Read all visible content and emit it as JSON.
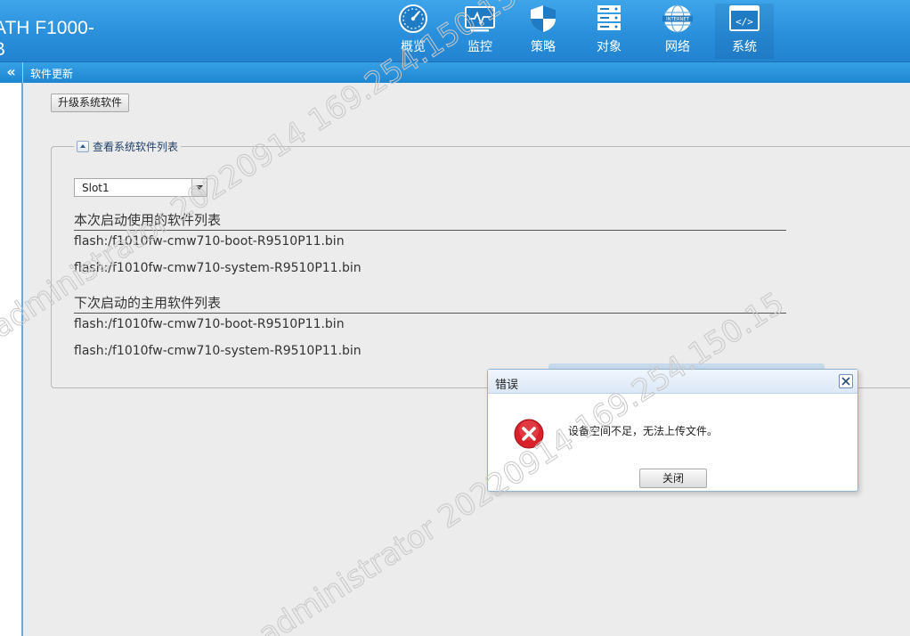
{
  "header": {
    "product_line1": "ATH F1000-",
    "product_line2": "B",
    "nav": [
      {
        "label": "概览",
        "icon": "dashboard-gauge-icon"
      },
      {
        "label": "监控",
        "icon": "monitor-pulse-icon"
      },
      {
        "label": "策略",
        "icon": "shield-icon"
      },
      {
        "label": "对象",
        "icon": "server-stack-icon"
      },
      {
        "label": "网络",
        "icon": "internet-globe-icon"
      },
      {
        "label": "系统",
        "icon": "code-window-icon"
      }
    ],
    "internet_badge": "INTERNET",
    "code_glyph": "</>",
    "active_nav": "系统"
  },
  "subheader": {
    "collapse_glyph": "«",
    "title": "软件更新"
  },
  "content": {
    "upgrade_button": "升级系统软件",
    "section_legend": "查看系统软件列表",
    "slot_select": {
      "value": "Slot1"
    },
    "current_boot": {
      "title": "本次启动使用的软件列表",
      "files": [
        "flash:/f1010fw-cmw710-boot-R9510P11.bin",
        "flash:/f1010fw-cmw710-system-R9510P11.bin"
      ]
    },
    "next_boot": {
      "title": "下次启动的主用软件列表",
      "files": [
        "flash:/f1010fw-cmw710-boot-R9510P11.bin",
        "flash:/f1010fw-cmw710-system-R9510P11.bin"
      ]
    }
  },
  "dialog": {
    "title": "错误",
    "message": "设备空间不足，无法上传文件。",
    "close_button": "关闭"
  },
  "watermark": {
    "text_a": "administrator 20220914 169.254.150.15",
    "text_b": "administrator 20220914 169.254.150.15"
  },
  "colors": {
    "header_blue": "#2a90dc",
    "error_red": "#d8212a",
    "dialog_border": "#8fb3d6"
  }
}
